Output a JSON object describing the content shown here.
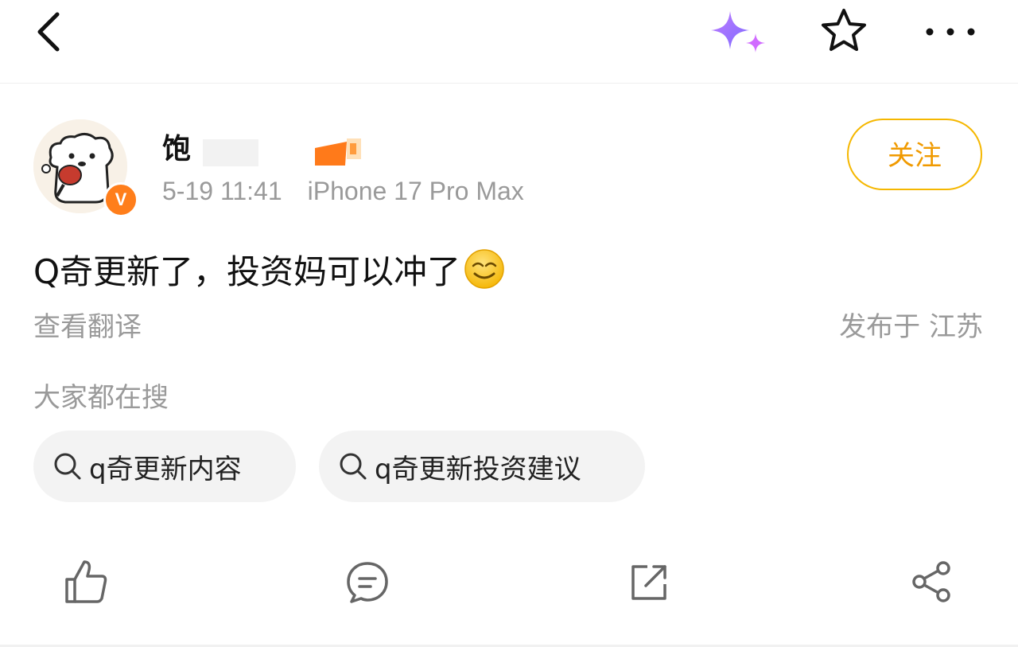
{
  "header": {
    "back_icon": "chevron-left-icon",
    "ai_icon": "sparkle-icon",
    "favorite_icon": "star-outline-icon",
    "more_icon": "more-horizontal-icon"
  },
  "post": {
    "author": {
      "name": "饱",
      "verified_badge": "V",
      "avatar_icon": "bear-avatar"
    },
    "time": "5-19 11:41",
    "device": "iPhone 17 Pro Max",
    "follow_label": "关注",
    "text": "Q奇更新了，投资妈可以冲了",
    "emoji": "smirk-emoji",
    "translate_label": "查看翻译",
    "location": "发布于 江苏"
  },
  "search": {
    "heading": "大家都在搜",
    "chips": [
      {
        "label": "q奇更新内容"
      },
      {
        "label": "q奇更新投资建议"
      }
    ]
  },
  "actions": {
    "like_icon": "thumbs-up-icon",
    "comment_icon": "comment-icon",
    "repost_icon": "repost-icon",
    "share_icon": "share-icon"
  },
  "colors": {
    "accent": "#f09a00",
    "follow_border": "#f5b700",
    "badge": "#ff7e1b",
    "muted_text": "#9a9a9a",
    "chip_bg": "#f3f3f3"
  }
}
